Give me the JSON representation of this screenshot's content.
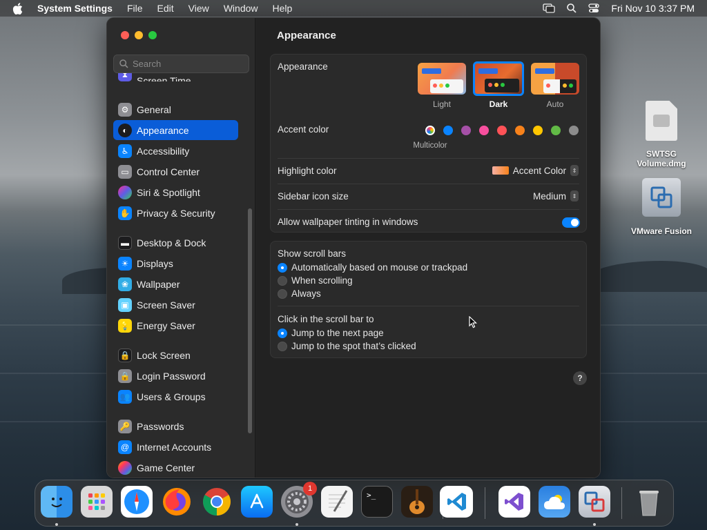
{
  "menubar": {
    "app_name": "System Settings",
    "items": [
      "File",
      "Edit",
      "View",
      "Window",
      "Help"
    ],
    "clock": "Fri Nov 10  3:37 PM"
  },
  "sidebar": {
    "search_placeholder": "Search",
    "items": [
      {
        "label": "Screen Time",
        "icon": "hourglass-icon",
        "color": "#5e5ce6"
      },
      {
        "label": "General",
        "icon": "gear-icon",
        "color": "#8e8e93"
      },
      {
        "label": "Appearance",
        "icon": "appearance-icon",
        "color": "#1c1c1e",
        "active": true
      },
      {
        "label": "Accessibility",
        "icon": "accessibility-icon",
        "color": "#0a84ff"
      },
      {
        "label": "Control Center",
        "icon": "control-center-icon",
        "color": "#8e8e93"
      },
      {
        "label": "Siri & Spotlight",
        "icon": "siri-icon",
        "color": "#bf5af2"
      },
      {
        "label": "Privacy & Security",
        "icon": "hand-icon",
        "color": "#0a84ff"
      },
      {
        "label": "Desktop & Dock",
        "icon": "desktop-icon",
        "color": "#1c1c1e"
      },
      {
        "label": "Displays",
        "icon": "sun-icon",
        "color": "#0a84ff"
      },
      {
        "label": "Wallpaper",
        "icon": "flower-icon",
        "color": "#32ade6"
      },
      {
        "label": "Screen Saver",
        "icon": "screen-saver-icon",
        "color": "#64d2ff"
      },
      {
        "label": "Energy Saver",
        "icon": "bulb-icon",
        "color": "#ffd60a"
      },
      {
        "label": "Lock Screen",
        "icon": "lock-icon",
        "color": "#1c1c1e"
      },
      {
        "label": "Login Password",
        "icon": "lock-icon",
        "color": "#8e8e93"
      },
      {
        "label": "Users & Groups",
        "icon": "users-icon",
        "color": "#0a84ff"
      },
      {
        "label": "Passwords",
        "icon": "key-icon",
        "color": "#8e8e93"
      },
      {
        "label": "Internet Accounts",
        "icon": "at-icon",
        "color": "#0a84ff"
      },
      {
        "label": "Game Center",
        "icon": "game-center-icon",
        "color": "#ff9f0a"
      }
    ]
  },
  "content": {
    "title": "Appearance",
    "appearance": {
      "label": "Appearance",
      "options": [
        "Light",
        "Dark",
        "Auto"
      ],
      "selected": "Dark"
    },
    "accent": {
      "label": "Accent color",
      "caption": "Multicolor",
      "colors": [
        "#ffffff",
        "#0a84ff",
        "#a550a7",
        "#f74f9e",
        "#ff5257",
        "#f7821b",
        "#ffc600",
        "#62ba46",
        "#8c8c8c"
      ]
    },
    "highlight": {
      "label": "Highlight color",
      "value": "Accent Color"
    },
    "sidebar_icon_size": {
      "label": "Sidebar icon size",
      "value": "Medium"
    },
    "wallpaper_tinting": {
      "label": "Allow wallpaper tinting in windows",
      "enabled": true
    },
    "scroll_bars": {
      "label": "Show scroll bars",
      "options": [
        "Automatically based on mouse or trackpad",
        "When scrolling",
        "Always"
      ],
      "selected": 0
    },
    "click_scroll": {
      "label": "Click in the scroll bar to",
      "options": [
        "Jump to the next page",
        "Jump to the spot that’s clicked"
      ],
      "selected": 0
    },
    "help": "?"
  },
  "desktop": {
    "icons": [
      {
        "label_line1": "SWTSG",
        "label_line2": "Volume.dmg"
      },
      {
        "label_line1": "VMware Fusion",
        "label_line2": ""
      }
    ]
  },
  "dock": {
    "apps": [
      "Finder",
      "Launchpad",
      "Safari",
      "Firefox",
      "Chrome",
      "App Store",
      "System Settings",
      "TextEdit",
      "Terminal",
      "GarageBand",
      "Visual Studio Code",
      "Visual Studio",
      "Weather",
      "VMware Fusion",
      "Trash"
    ],
    "system_settings_badge": "1"
  }
}
